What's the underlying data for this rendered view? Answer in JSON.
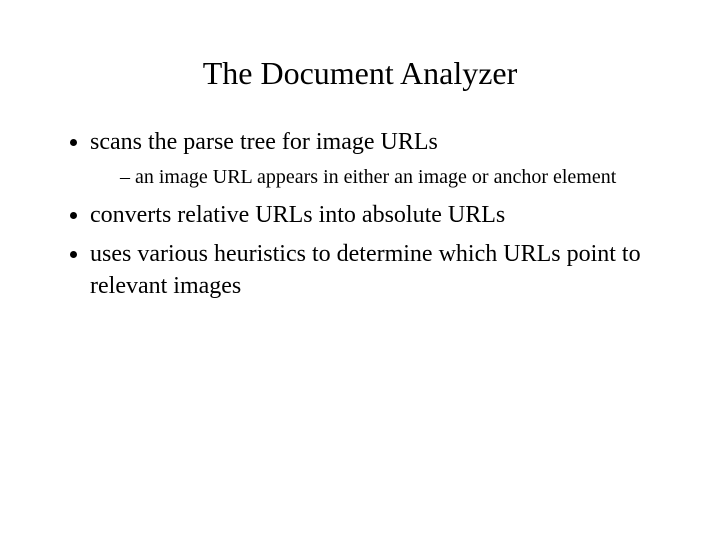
{
  "slide": {
    "title": "The Document Analyzer",
    "bullets": [
      {
        "text": "scans the parse tree for image URLs",
        "sub": [
          "an image URL appears in either an image or anchor element"
        ]
      },
      {
        "text": "converts relative URLs into absolute URLs"
      },
      {
        "text": "uses various heuristics to determine which URLs point to relevant images"
      }
    ]
  }
}
